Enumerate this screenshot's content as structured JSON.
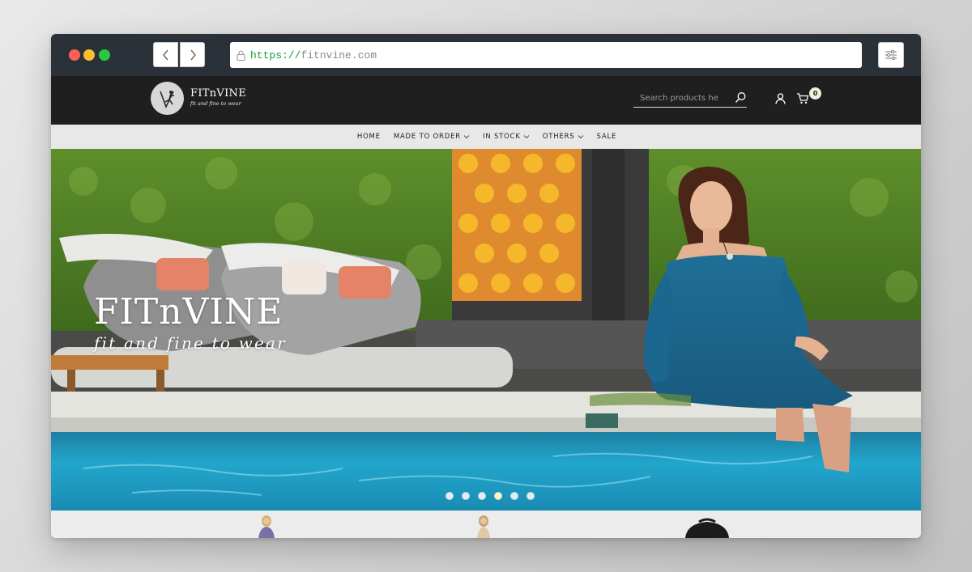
{
  "browser": {
    "url_scheme": "https://",
    "url_host": "fitnvine.com",
    "icons": [
      "back-icon",
      "forward-icon",
      "lock-icon",
      "settings-sliders-icon"
    ]
  },
  "site": {
    "logo_name": "FITnVINE",
    "logo_tagline": "fit and fine to wear",
    "search_placeholder": "Search products he",
    "cart_count": "0"
  },
  "nav": {
    "items": [
      {
        "label": "HOME",
        "dropdown": false
      },
      {
        "label": "MADE TO ORDER",
        "dropdown": true
      },
      {
        "label": "IN STOCK",
        "dropdown": true
      },
      {
        "label": "OTHERS",
        "dropdown": true
      },
      {
        "label": "SALE",
        "dropdown": false
      }
    ]
  },
  "hero": {
    "title": "FITnVINE",
    "subtitle": "fit and fine to wear",
    "slide_count": 6,
    "active_slide": 4
  },
  "colors": {
    "chrome": "#2b3139",
    "site_header": "#1f1f1f",
    "nav_bar": "#e8e8e8",
    "pool": "#1f9cc4",
    "dress": "#1e6c93"
  }
}
